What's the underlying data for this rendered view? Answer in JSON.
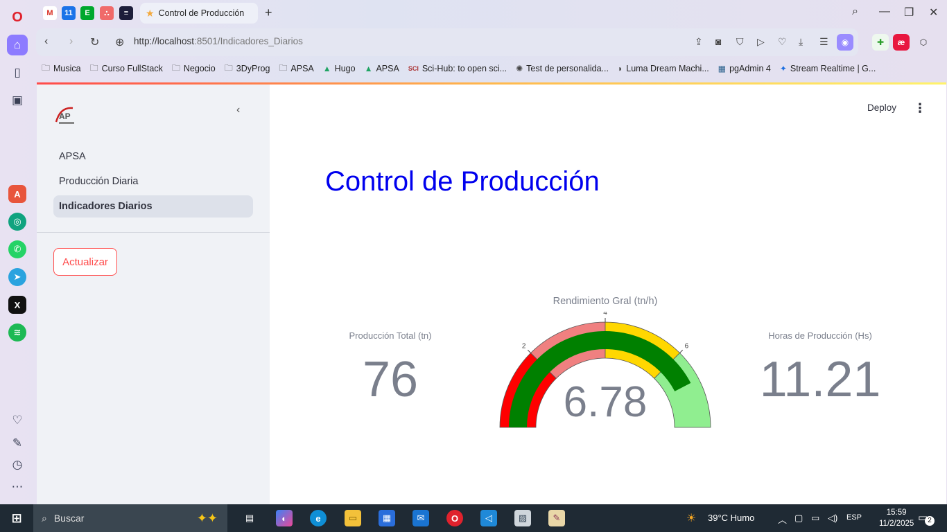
{
  "browser": {
    "tab_title": "Control de Producción",
    "url_host": "http://localhost",
    "url_rest": ":8501/Indicadores_Diarios",
    "bookmarks": [
      "Musica",
      "Curso FullStack",
      "Negocio",
      "3DyProg",
      "APSA",
      "Hugo",
      "APSA",
      "Sci-Hub: to open sci...",
      "Test de personalida...",
      "Luma Dream Machi...",
      "pgAdmin 4",
      "Stream Realtime | G..."
    ]
  },
  "sidebar": {
    "logo_text": "AP",
    "items": [
      {
        "label": "APSA"
      },
      {
        "label": "Producción Diaria"
      },
      {
        "label": "Indicadores Diarios"
      }
    ],
    "refresh_button": "Actualizar"
  },
  "header": {
    "deploy": "Deploy"
  },
  "main": {
    "title": "Control de Producción",
    "metric_total_label": "Producción Total (tn)",
    "metric_total_value": "76",
    "metric_hours_label": "Horas de Producción (Hs)",
    "metric_hours_value": "11.21"
  },
  "chart_data": {
    "type": "gauge",
    "title": "Rendimiento Gral (tn/h)",
    "value": 6.78,
    "value_label": "6.78",
    "range": [
      0,
      8
    ],
    "ticks": [
      2,
      4,
      6
    ],
    "steps": [
      {
        "range": [
          0,
          2
        ],
        "color": "#ff0000"
      },
      {
        "range": [
          2,
          4
        ],
        "color": "#f08080"
      },
      {
        "range": [
          4,
          6
        ],
        "color": "#ffd700"
      },
      {
        "range": [
          6,
          8
        ],
        "color": "#90ee90"
      }
    ],
    "bar_color": "#008000"
  },
  "taskbar": {
    "search": "Buscar",
    "weather": "39°C  Humo",
    "lang": "ESP",
    "time": "15:59",
    "date": "11/2/2025",
    "notifications": "2"
  }
}
